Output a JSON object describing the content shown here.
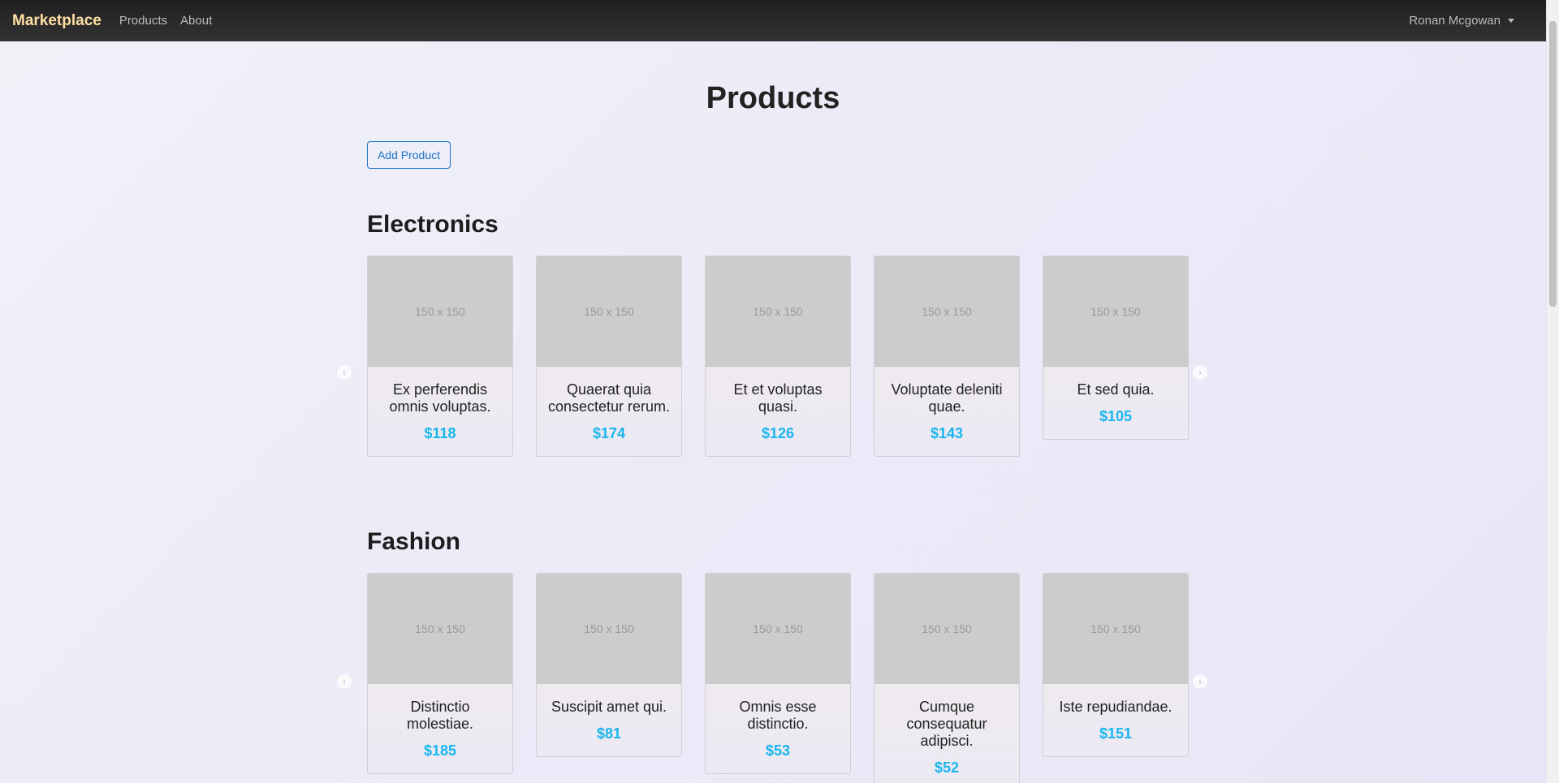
{
  "navbar": {
    "brand": "Marketplace",
    "links": [
      "Products",
      "About"
    ],
    "user": "Ronan Mcgowan"
  },
  "page": {
    "title": "Products",
    "add_button": "Add Product"
  },
  "sections": [
    {
      "title": "Electronics",
      "products": [
        {
          "image_placeholder": "150 x 150",
          "name": "Ex perferendis omnis voluptas.",
          "price": "$118"
        },
        {
          "image_placeholder": "150 x 150",
          "name": "Quaerat quia consectetur rerum.",
          "price": "$174"
        },
        {
          "image_placeholder": "150 x 150",
          "name": "Et et voluptas quasi.",
          "price": "$126"
        },
        {
          "image_placeholder": "150 x 150",
          "name": "Voluptate deleniti quae.",
          "price": "$143"
        },
        {
          "image_placeholder": "150 x 150",
          "name": "Et sed quia.",
          "price": "$105"
        }
      ]
    },
    {
      "title": "Fashion",
      "products": [
        {
          "image_placeholder": "150 x 150",
          "name": "Distinctio molestiae.",
          "price": "$185"
        },
        {
          "image_placeholder": "150 x 150",
          "name": "Suscipit amet qui.",
          "price": "$81"
        },
        {
          "image_placeholder": "150 x 150",
          "name": "Omnis esse distinctio.",
          "price": "$53"
        },
        {
          "image_placeholder": "150 x 150",
          "name": "Cumque consequatur adipisci.",
          "price": "$52"
        },
        {
          "image_placeholder": "150 x 150",
          "name": "Iste repudiandae.",
          "price": "$151"
        }
      ]
    }
  ],
  "colors": {
    "brand": "#ffe0a3",
    "price": "#18b6ee",
    "button": "#1a73c7"
  },
  "icons": {
    "prev": "chevron-left-icon",
    "next": "chevron-right-icon"
  }
}
